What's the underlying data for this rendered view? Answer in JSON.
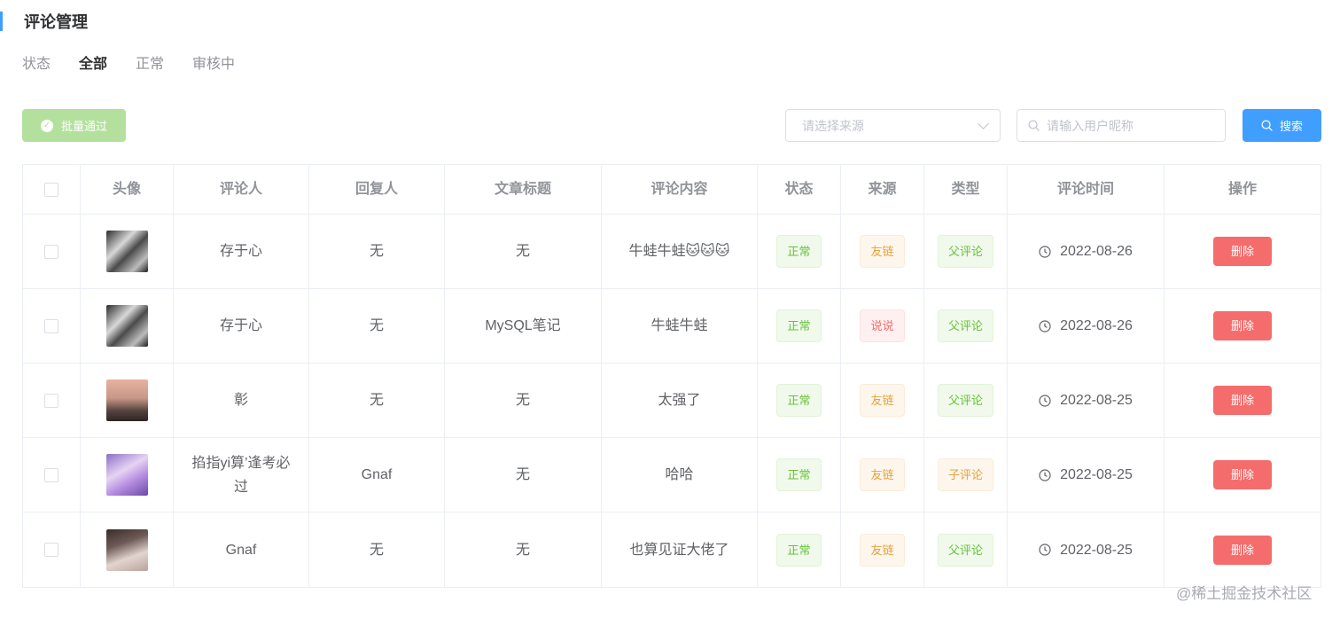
{
  "page": {
    "title": "评论管理"
  },
  "status_filter": {
    "label": "状态",
    "tabs": [
      {
        "label": "全部",
        "active": true
      },
      {
        "label": "正常",
        "active": false
      },
      {
        "label": "审核中",
        "active": false
      }
    ]
  },
  "toolbar": {
    "batch_approve_label": "批量通过",
    "source_select_placeholder": "请选择来源",
    "search_placeholder": "请输入用户昵称",
    "search_button_label": "搜索"
  },
  "table": {
    "headers": [
      "头像",
      "评论人",
      "回复人",
      "文章标题",
      "评论内容",
      "状态",
      "来源",
      "类型",
      "评论时间",
      "操作"
    ],
    "delete_label": "删除",
    "rows": [
      {
        "commenter": "存于心",
        "reply_to": "无",
        "article": "无",
        "content": "牛蛙牛蛙🐱🐱🐱",
        "status": "正常",
        "source": "友链",
        "type": "父评论",
        "time": "2022-08-26"
      },
      {
        "commenter": "存于心",
        "reply_to": "无",
        "article": "MySQL笔记",
        "content": "牛蛙牛蛙",
        "status": "正常",
        "source": "说说",
        "type": "父评论",
        "time": "2022-08-26"
      },
      {
        "commenter": "彰",
        "reply_to": "无",
        "article": "无",
        "content": "太强了",
        "status": "正常",
        "source": "友链",
        "type": "父评论",
        "time": "2022-08-25"
      },
      {
        "commenter": "掐指yi算’逢考必过",
        "reply_to": "Gnaf",
        "article": "无",
        "content": "哈哈",
        "status": "正常",
        "source": "友链",
        "type": "子评论",
        "time": "2022-08-25"
      },
      {
        "commenter": "Gnaf",
        "reply_to": "无",
        "article": "无",
        "content": "也算见证大佬了",
        "status": "正常",
        "source": "友链",
        "type": "父评论",
        "time": "2022-08-25"
      }
    ]
  },
  "watermark": "@稀土掘金技术社区",
  "colors": {
    "primary": "#409eff",
    "success": "#67c23a",
    "warning": "#e6a23c",
    "danger": "#f56c6c"
  }
}
